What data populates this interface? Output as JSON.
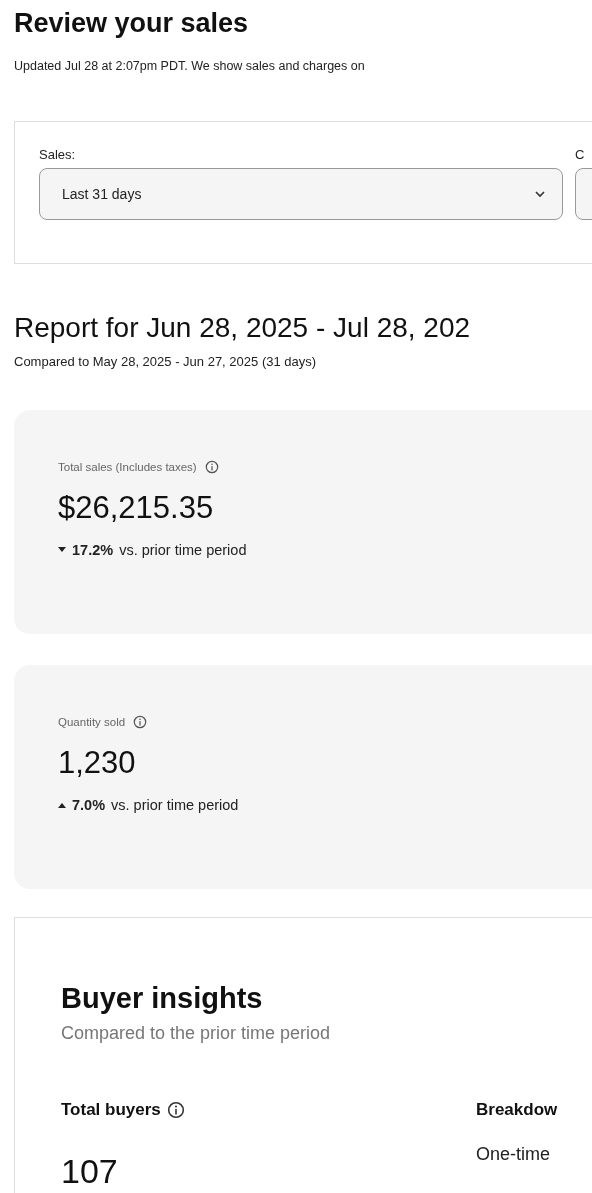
{
  "header": {
    "title": "Review your sales",
    "subtitle": "Updated Jul 28 at 2:07pm PDT. We show sales and charges on"
  },
  "filters": [
    {
      "label": "Sales:",
      "value": "Last 31 days"
    },
    {
      "label": "C"
    }
  ],
  "report": {
    "title": "Report for Jun 28, 2025 - Jul 28, 202",
    "comparison": "Compared to May 28, 2025 - Jun 27, 2025 (31 days)"
  },
  "metrics": [
    {
      "label": "Total sales (Includes taxes)",
      "value": "$26,215.35",
      "kind": "down",
      "change": "17.2%",
      "change_note": "vs. prior time period"
    },
    {
      "label": "Quantity sold",
      "value": "1,230",
      "kind": "up",
      "change": "7.0%",
      "change_note": "vs. prior time period"
    }
  ],
  "buyer_insights": {
    "title": "Buyer insights",
    "subtitle": "Compared to the prior time period",
    "total_label": "Total buyers",
    "total_value": "107",
    "breakdown_label": "Breakdow",
    "breakdown_items": [
      "One-time"
    ]
  }
}
